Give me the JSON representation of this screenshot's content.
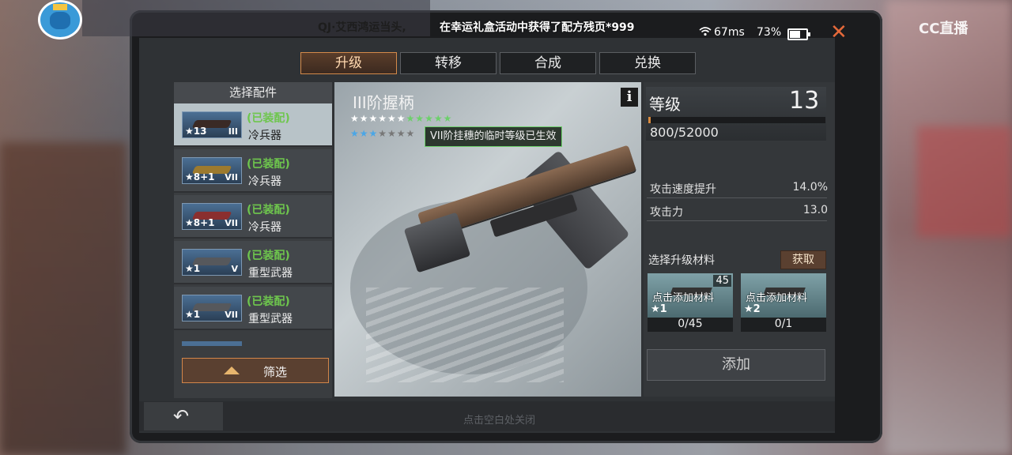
{
  "overlay": {
    "ticker_left": "QJ·艾西鸿运当头,",
    "ticker": "在幸运礼盒活动中获得了配方残页*999",
    "ping": "67ms",
    "battery": "73%",
    "battery_level": 0.73,
    "close_glyph": "✕",
    "cc_logo": "CC直播"
  },
  "tabs": [
    {
      "label": "升级",
      "active": true
    },
    {
      "label": "转移",
      "active": false
    },
    {
      "label": "合成",
      "active": false
    },
    {
      "label": "兑换",
      "active": false
    }
  ],
  "list": {
    "header": "选择配件",
    "items": [
      {
        "stars": "★13",
        "tier": "III",
        "equipped": "(已装配)",
        "type": "冷兵器",
        "selected": true
      },
      {
        "stars": "★8+1",
        "tier": "VII",
        "equipped": "(已装配)",
        "type": "冷兵器",
        "selected": false
      },
      {
        "stars": "★8+1",
        "tier": "VII",
        "equipped": "(已装配)",
        "type": "冷兵器",
        "selected": false
      },
      {
        "stars": "★1",
        "tier": "V",
        "equipped": "(已装配)",
        "type": "重型武器",
        "selected": false
      },
      {
        "stars": "★1",
        "tier": "VII",
        "equipped": "(已装配)",
        "type": "重型武器",
        "selected": false
      }
    ],
    "filter_label": "筛选"
  },
  "detail": {
    "name": "III阶握柄",
    "info_glyph": "i",
    "star_row1_white": "★★★★★★",
    "star_row1_green": "★★★★★",
    "star_row2_blue": "★★★",
    "star_row2_grey": "★★★★",
    "tooltip": "VII阶挂穗的临时等级已生效"
  },
  "stats": {
    "level_label": "等级",
    "level": "13",
    "xp_text": "800/52000",
    "xp_fraction": 0.0154,
    "attack_speed_label": "攻击速度提升",
    "attack_speed_value": "14.0%",
    "attack_label": "攻击力",
    "attack_value": "13.0"
  },
  "materials": {
    "label": "选择升级材料",
    "get_label": "获取",
    "slots": [
      {
        "hint": "点击添加材料",
        "badge": "45",
        "star": "★1",
        "qty": "0/45"
      },
      {
        "hint": "点击添加材料",
        "badge": "",
        "star": "★2",
        "qty": "0/1"
      }
    ],
    "add_label": "添加"
  },
  "bottom": {
    "back_glyph": "↶",
    "close_hint": "点击空白处关闭"
  }
}
